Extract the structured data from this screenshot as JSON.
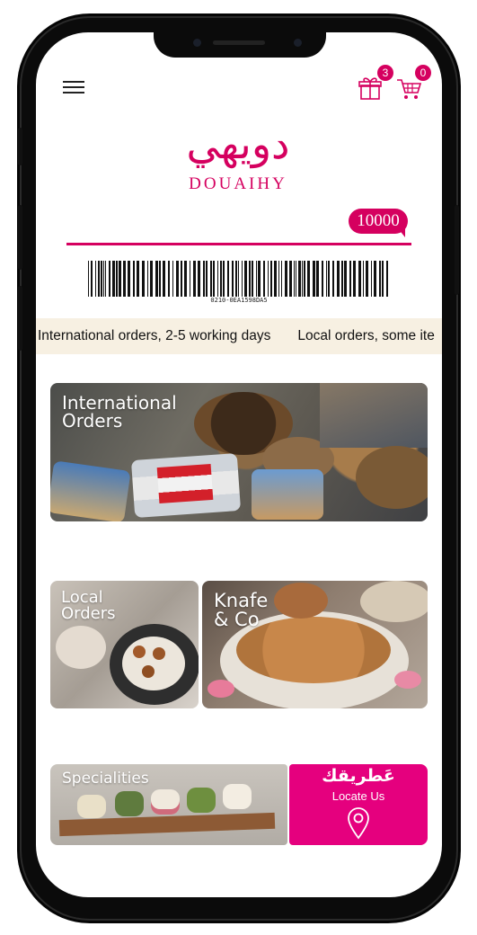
{
  "header": {
    "menu_icon": "hamburger-icon",
    "gift_icon": "gift-icon",
    "gift_count": "3",
    "cart_icon": "cart-icon",
    "cart_count": "0",
    "accent": "#d5005f"
  },
  "brand": {
    "arabic": "دويهي",
    "latin": "DOUAIHY"
  },
  "loyalty": {
    "points": "10000",
    "barcode_text": "0210-0EA1598DA5"
  },
  "ticker": {
    "messages": [
      "International orders, 2-5 working days",
      "Local orders, some ite"
    ]
  },
  "tiles": {
    "international": {
      "line1": "International",
      "line2": "Orders"
    },
    "local": {
      "line1": "Local",
      "line2": "Orders"
    },
    "knafe": {
      "line1": "Knafe",
      "line2": "& Co"
    },
    "specialities": {
      "label": "Specialities"
    },
    "locate": {
      "arabic": "عَطريقك",
      "label": "Locate Us",
      "icon": "map-pin-icon",
      "color": "#e5007e"
    }
  }
}
